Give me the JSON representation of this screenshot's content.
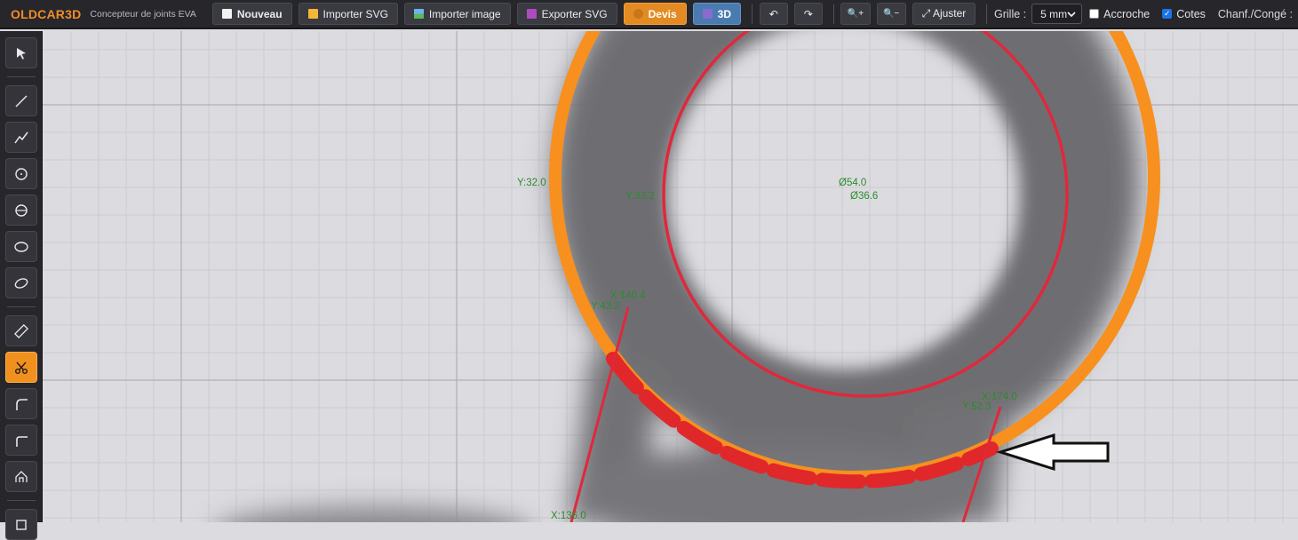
{
  "app": {
    "name": "OLDCAR3D",
    "subtitle": "Concepteur de joints EVA"
  },
  "toolbar": {
    "nouveau": "Nouveau",
    "importer_svg": "Importer SVG",
    "importer_image": "Importer image",
    "exporter_svg": "Exporter SVG",
    "devis": "Devis",
    "trois_d": "3D",
    "undo": "↶",
    "redo": "↷",
    "zoom_in": "🔍+",
    "zoom_out": "🔍−",
    "ajuster": "⤢ Ajuster",
    "grille_label": "Grille :",
    "grille_value": "5 mm",
    "accroche_label": "Accroche",
    "accroche_checked": false,
    "cotes_label": "Cotes",
    "cotes_checked": true,
    "chanf_label": "Chanf./Congé :"
  },
  "tools": [
    "select-tool",
    "line-tool",
    "polyline-tool",
    "circle-tool",
    "circle-center-tool",
    "ellipse-tool",
    "rotated-ellipse-tool",
    "measure-tool",
    "scissors-tool",
    "fillet-tool",
    "chamfer-tool",
    "arch-tool",
    "rectangle-tool"
  ],
  "active_tool": "scissors-tool",
  "colors": {
    "accent": "#f28c28",
    "outer_ring": "#f7901e",
    "cut_segment": "#e0282a",
    "inner_circle": "#e0283c",
    "dimension_text": "#2c8a2c"
  },
  "dimensions": {
    "y32_0": "Y:32.0",
    "y33_2": "Y:33.2",
    "d54_0": "Ø54.0",
    "d36_6": "Ø36.6",
    "x140_4": "X:140.4",
    "y43_2": "Y:43.2",
    "x174_0": "X:174.0",
    "y52_3": "Y:52.3",
    "x136_0": "X:136.0"
  }
}
